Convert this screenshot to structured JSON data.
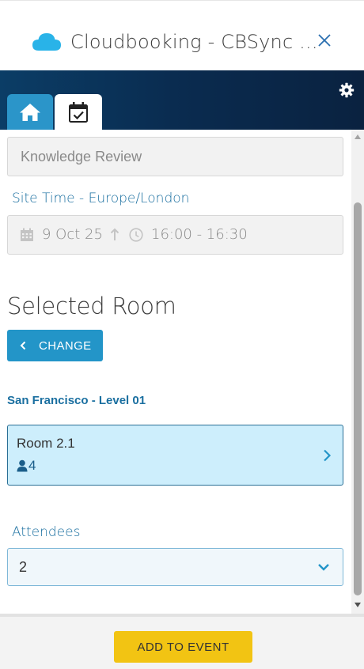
{
  "window": {
    "title": "Cloudbooking - CBSync ...",
    "logo_icon": "cloud-icon",
    "close_icon": "close-icon"
  },
  "navbar": {
    "settings_icon": "gear-icon",
    "tabs": [
      {
        "icon": "home-icon",
        "active": false
      },
      {
        "icon": "calendar-check-icon",
        "active": true
      }
    ]
  },
  "booking": {
    "meeting_title": "Knowledge Review",
    "site_time_label": "Site Time - Europe/London",
    "date": "9 Oct 25",
    "time": "16:00 - 16:30"
  },
  "selected_room": {
    "heading": "Selected Room",
    "change_label": "CHANGE",
    "location": "San Francisco - Level 01",
    "room_name": "Room 2.1",
    "capacity": "4"
  },
  "attendees": {
    "label": "Attendees",
    "value": "2"
  },
  "footer": {
    "add_label": "ADD TO EVENT"
  },
  "colors": {
    "navbar": "#0a2b4f",
    "accent_blue": "#2395c8",
    "link_blue": "#1a6fa0",
    "room_card_bg": "#cdeefc",
    "add_button": "#f2c413"
  }
}
